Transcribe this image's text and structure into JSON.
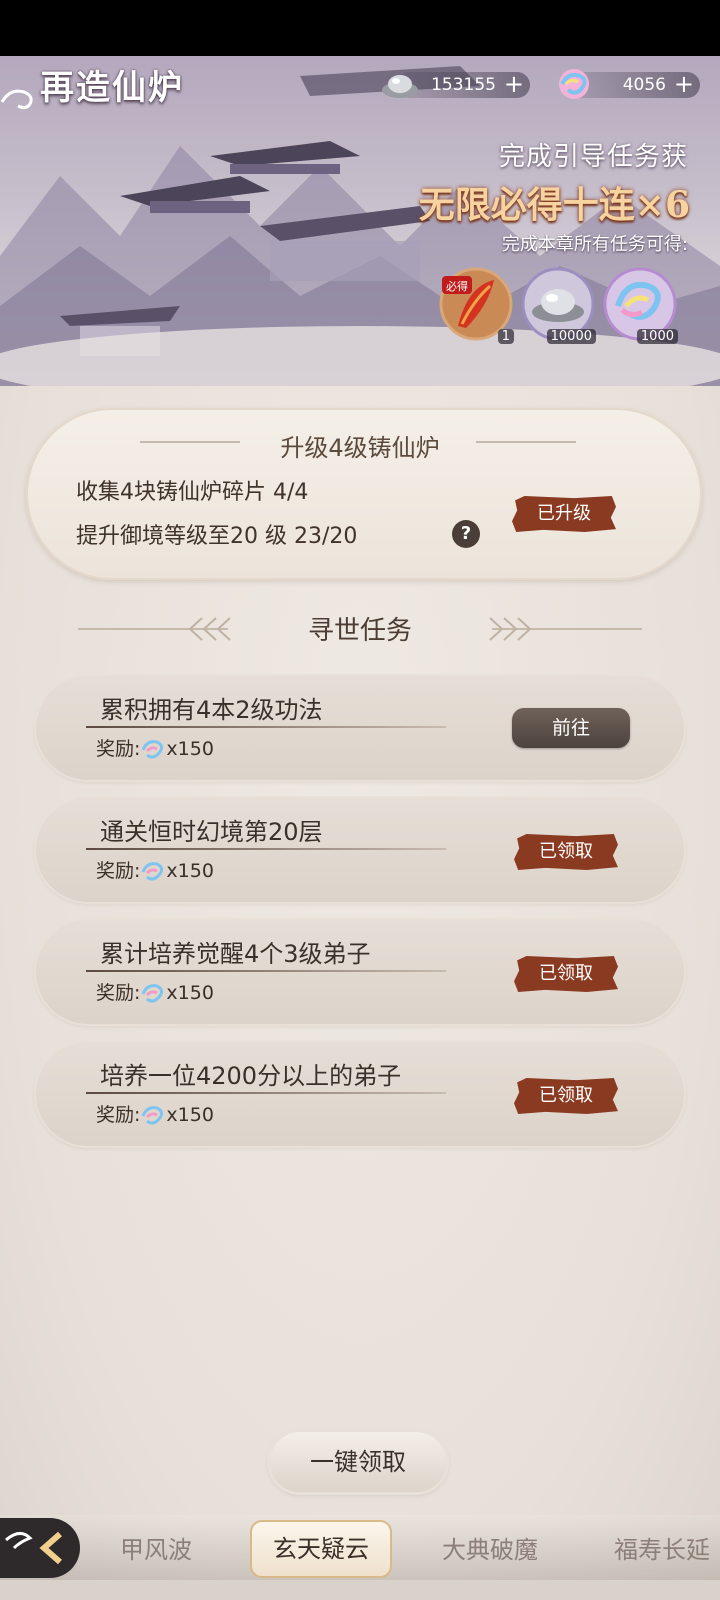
{
  "header": {
    "title": "再造仙炉",
    "silver": "153155",
    "gems": "4056",
    "plus": "+"
  },
  "reward_banner": {
    "headline": "完成引导任务获",
    "big": "无限必得十连×6",
    "sub": "完成本章所有任务可得:",
    "items": [
      {
        "icon": "feather-draw-icon",
        "badge": "必得",
        "count": "1"
      },
      {
        "icon": "silver-ingot-icon",
        "count": "10000"
      },
      {
        "icon": "rainbow-gem-icon",
        "count": "1000"
      }
    ]
  },
  "upgrade": {
    "title": "升级4级铸仙炉",
    "line1": "收集4块铸仙炉碎片   4/4",
    "line2": "提升御境等级至20 级  23/20",
    "help": "?",
    "status": "已升级"
  },
  "section": {
    "title": "寻世任务"
  },
  "tasks": [
    {
      "name": "累积拥有4本2级功法",
      "reward_label": "奖励:",
      "reward_amount": "x150",
      "action": "前往"
    },
    {
      "name": "通关恒时幻境第20层",
      "reward_label": "奖励:",
      "reward_amount": "x150",
      "action": "已领取"
    },
    {
      "name": "累计培养觉醒4个3级弟子",
      "reward_label": "奖励:",
      "reward_amount": "x150",
      "action": "已领取"
    },
    {
      "name": "培养一位4200分以上的弟子",
      "reward_label": "奖励:",
      "reward_amount": "x150",
      "action": "已领取"
    }
  ],
  "claim_all": "一键领取",
  "tabs": [
    "甲风波",
    "玄天疑云",
    "大典破魔",
    "福寿长延"
  ],
  "colors": {
    "stamp": "#8b3a22",
    "accent": "#f7d3a0"
  }
}
